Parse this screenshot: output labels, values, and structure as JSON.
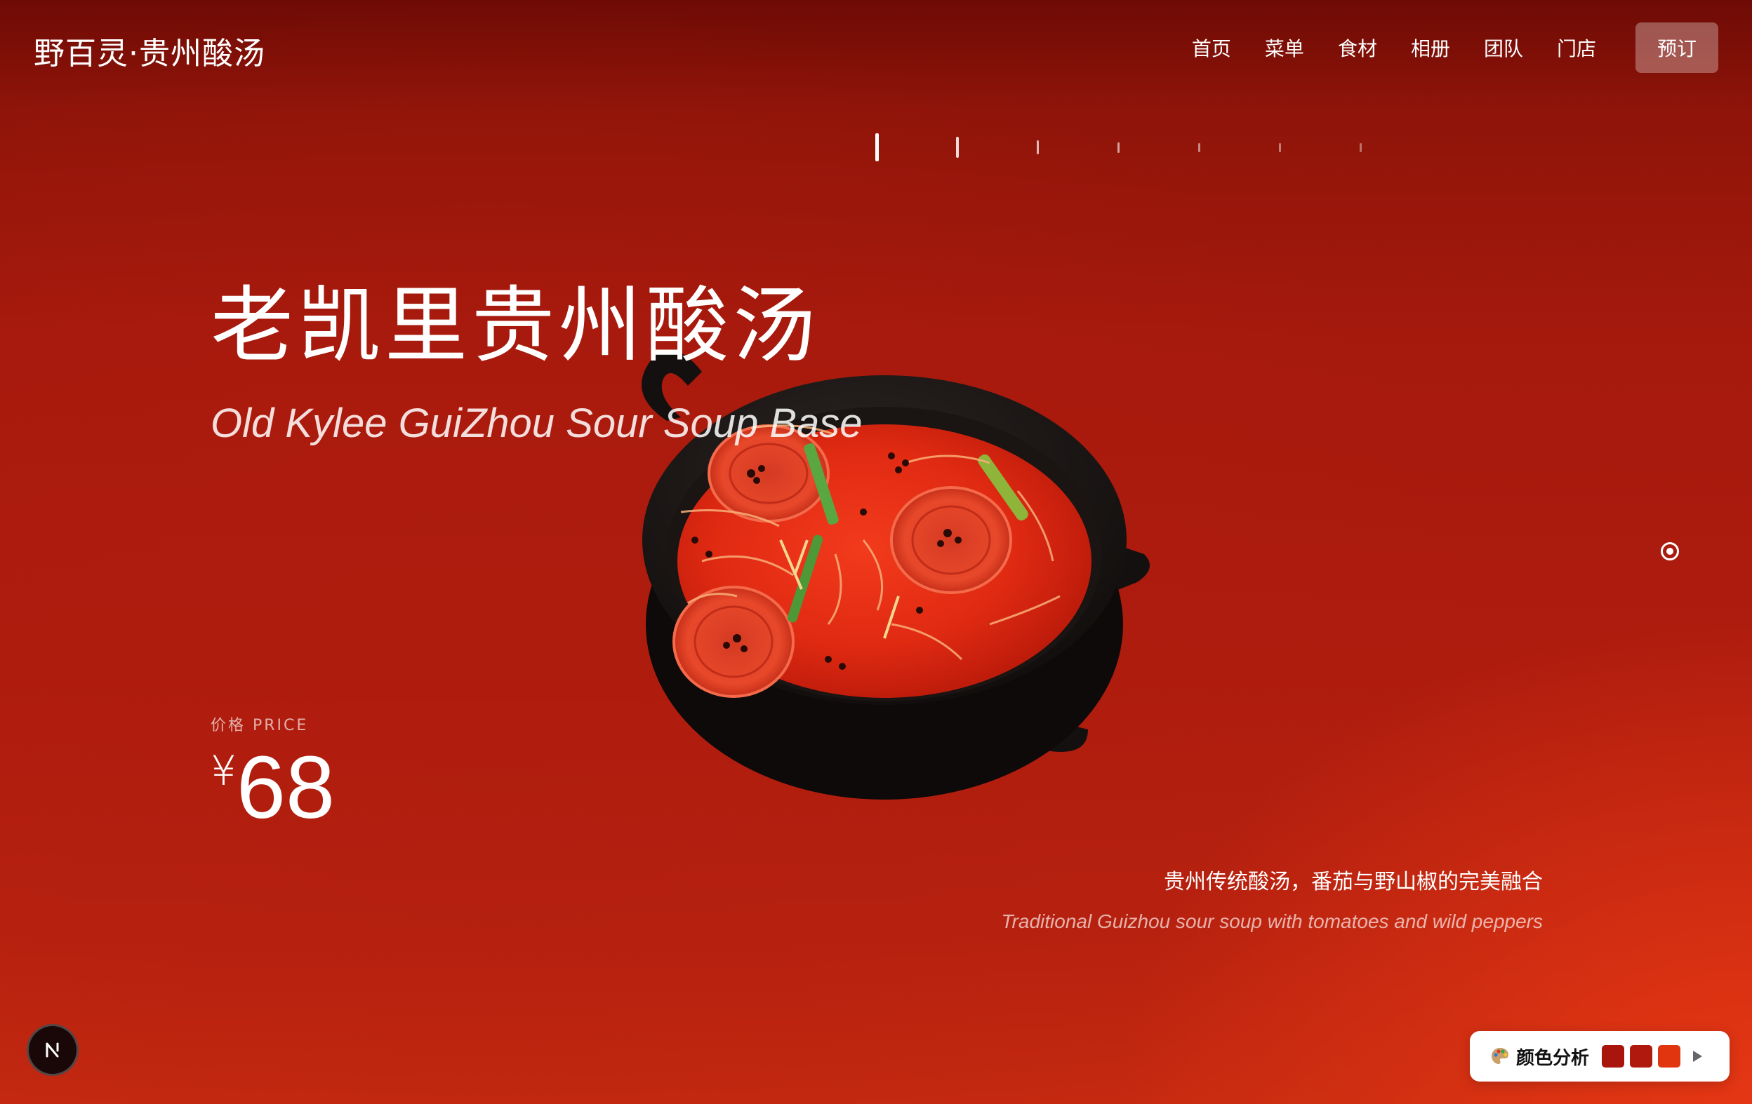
{
  "header": {
    "brand": "野百灵·贵州酸汤",
    "nav": [
      "首页",
      "菜单",
      "食材",
      "相册",
      "团队",
      "门店"
    ],
    "reserve_label": "预订"
  },
  "slider": {
    "total": 7,
    "active_index": 0
  },
  "dish": {
    "title_cn": "老凯里贵州酸汤",
    "title_en": "Old Kylee GuiZhou Sour Soup Base",
    "price_label": "价格 PRICE",
    "currency": "¥",
    "price": "68",
    "description_cn": "贵州传统酸汤，番茄与野山椒的完美融合",
    "description_en": "Traditional Guizhou sour soup with tomatoes and wild peppers"
  },
  "badge": {
    "letter": "N"
  },
  "color_widget": {
    "icon": "palette-icon",
    "label": "颜色分析",
    "swatches": [
      "#a9150c",
      "#b01a0e",
      "#e0350f"
    ],
    "play_icon": "play-icon"
  },
  "colors": {
    "background_top": "#6e0b05",
    "background_mid": "#ae1c0e",
    "background_corner": "#e6371a"
  }
}
